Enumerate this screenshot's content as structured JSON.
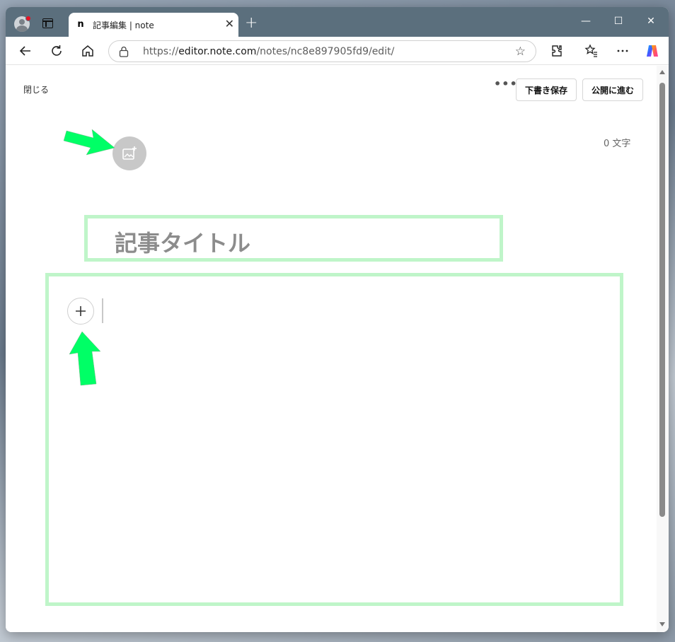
{
  "browser": {
    "tab_title": "記事編集 | note",
    "favicon_letter": "n",
    "url_prefix": "https://",
    "url_host": "editor.note.com",
    "url_path": "/notes/nc8e897905fd9/edit/",
    "new_tab_symbol": "+",
    "close_tab_symbol": "✕",
    "window_controls": {
      "minimize": "—",
      "maximize": "☐",
      "close": "✕"
    },
    "toolbar_icons": [
      "back-icon",
      "refresh-icon",
      "home-icon",
      "extensions-icon",
      "favorites-icon",
      "more-icon",
      "copilot-icon"
    ]
  },
  "editor": {
    "close_label": "閉じる",
    "more_label": "•••",
    "save_draft_label": "下書き保存",
    "publish_label": "公開に進む",
    "char_count": "0 文字",
    "title_placeholder": "記事タイトル",
    "add_block_symbol": "+"
  },
  "colors": {
    "highlight_border": "#bff5c9",
    "annotation_arrow": "#00ff66",
    "titlebar": "#5b6f7d"
  }
}
